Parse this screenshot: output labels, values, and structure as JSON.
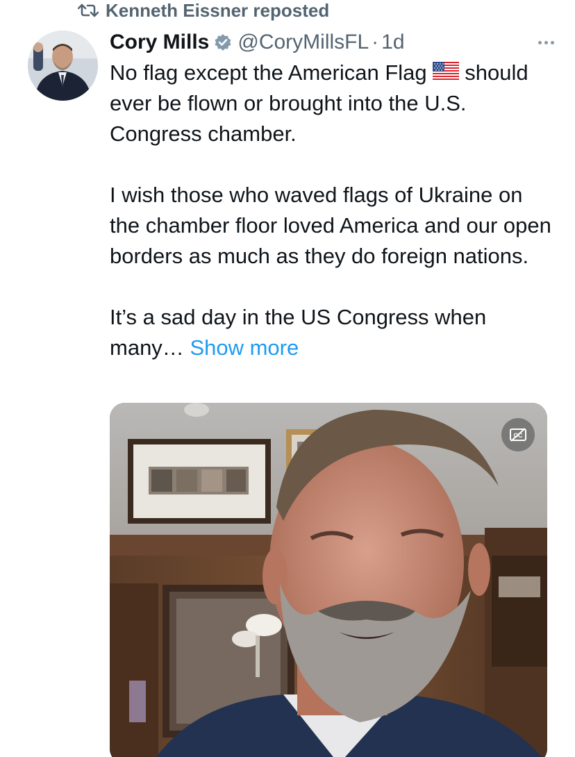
{
  "repost": {
    "icon": "repost-icon",
    "text": "Kenneth Eissner reposted"
  },
  "author": {
    "name": "Cory Mills",
    "verified_icon": "verified-badge-icon",
    "handle": "@CoryMillsFL",
    "separator": "·",
    "time": "1d"
  },
  "tweet": {
    "line1": "No flag except the American Flag",
    "flag_icon": "us-flag-emoji",
    "line1_rest": "should ever be flown or brought into the U.S. Congress chamber.",
    "paragraph2": "I wish those who waved flags of Ukraine on the chamber floor loved America and our open borders as much as they do foreign nations.",
    "paragraph3": "It’s a sad day in the US Congress when many…",
    "show_more": "Show more"
  },
  "media": {
    "type": "video",
    "captions_icon": "captions-off-icon"
  },
  "colors": {
    "accent": "#1d9bf0",
    "secondary_text": "#536471",
    "primary_text": "#0f1419"
  }
}
